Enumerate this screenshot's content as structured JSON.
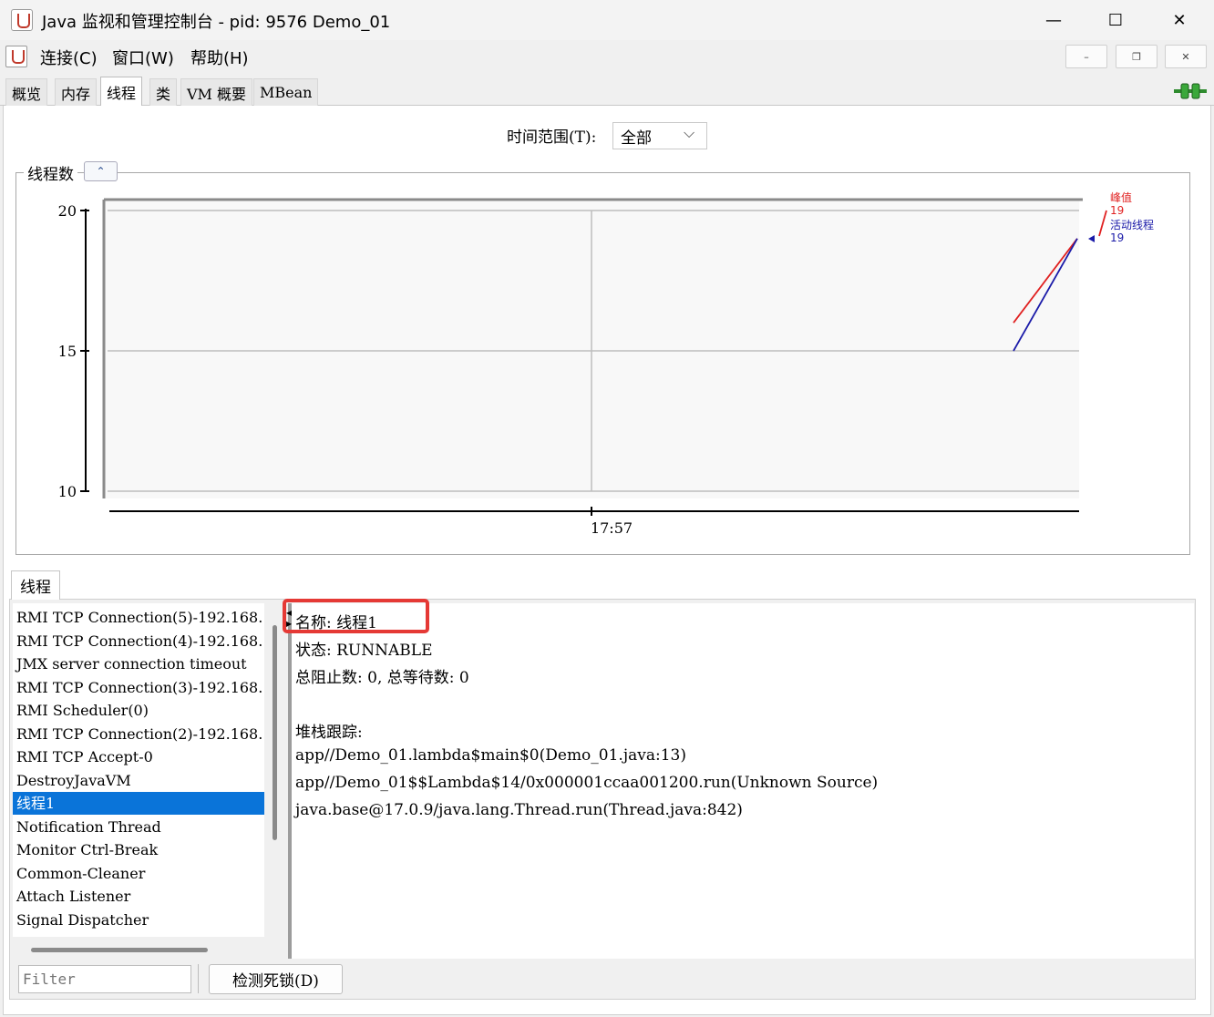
{
  "window": {
    "title": "Java 监视和管理控制台 - pid: 9576 Demo_01",
    "minimize": "—",
    "maximize": "☐",
    "close": "✕"
  },
  "menubar": {
    "items": [
      "连接(C)",
      "窗口(W)",
      "帮助(H)"
    ],
    "mdi_minimize": "–",
    "mdi_restore": "❐",
    "mdi_close": "✕"
  },
  "tabs": [
    "概览",
    "内存",
    "线程",
    "类",
    "VM 概要",
    "MBean"
  ],
  "active_tab": "线程",
  "time_range": {
    "label": "时间范围(T):",
    "value": "全部",
    "arrow": "⌵"
  },
  "chart_group": {
    "title": "线程数",
    "collapse_symbol": "⌃"
  },
  "chart_data": {
    "type": "line",
    "title": "线程数",
    "ylim": [
      10,
      20
    ],
    "y_ticks": [
      "20",
      "15",
      "10"
    ],
    "x_ticks": [
      "17:57"
    ],
    "series": [
      {
        "name": "峰值",
        "color": "#e02020",
        "y_start": 16,
        "y_end": 19,
        "last_value": "19"
      },
      {
        "name": "活动线程",
        "color": "#1a1aa8",
        "y_start": 15,
        "y_end": 19,
        "last_value": "19"
      }
    ]
  },
  "threads_section": {
    "tab_label": "线程",
    "list": [
      "RMI TCP Connection(5)-192.168.",
      "RMI TCP Connection(4)-192.168.",
      "JMX server connection timeout",
      "RMI TCP Connection(3)-192.168.",
      "RMI Scheduler(0)",
      "RMI TCP Connection(2)-192.168.",
      "RMI TCP Accept-0",
      "DestroyJavaVM",
      "线程1",
      "Notification Thread",
      "Monitor Ctrl-Break",
      "Common-Cleaner",
      "Attach Listener",
      "Signal Dispatcher",
      "..."
    ],
    "selected": "线程1",
    "details": [
      "名称: 线程1",
      "状态: RUNNABLE",
      "总阻止数: 0, 总等待数: 0",
      "",
      "堆栈跟踪:",
      "app//Demo_01.lambda$main$0(Demo_01.java:13)",
      "app//Demo_01$$Lambda$14/0x000001ccaa001200.run(Unknown Source)",
      "java.base@17.0.9/java.lang.Thread.run(Thread.java:842)"
    ],
    "filter_placeholder": "Filter",
    "detect_deadlock_label": "检测死锁(D)"
  }
}
